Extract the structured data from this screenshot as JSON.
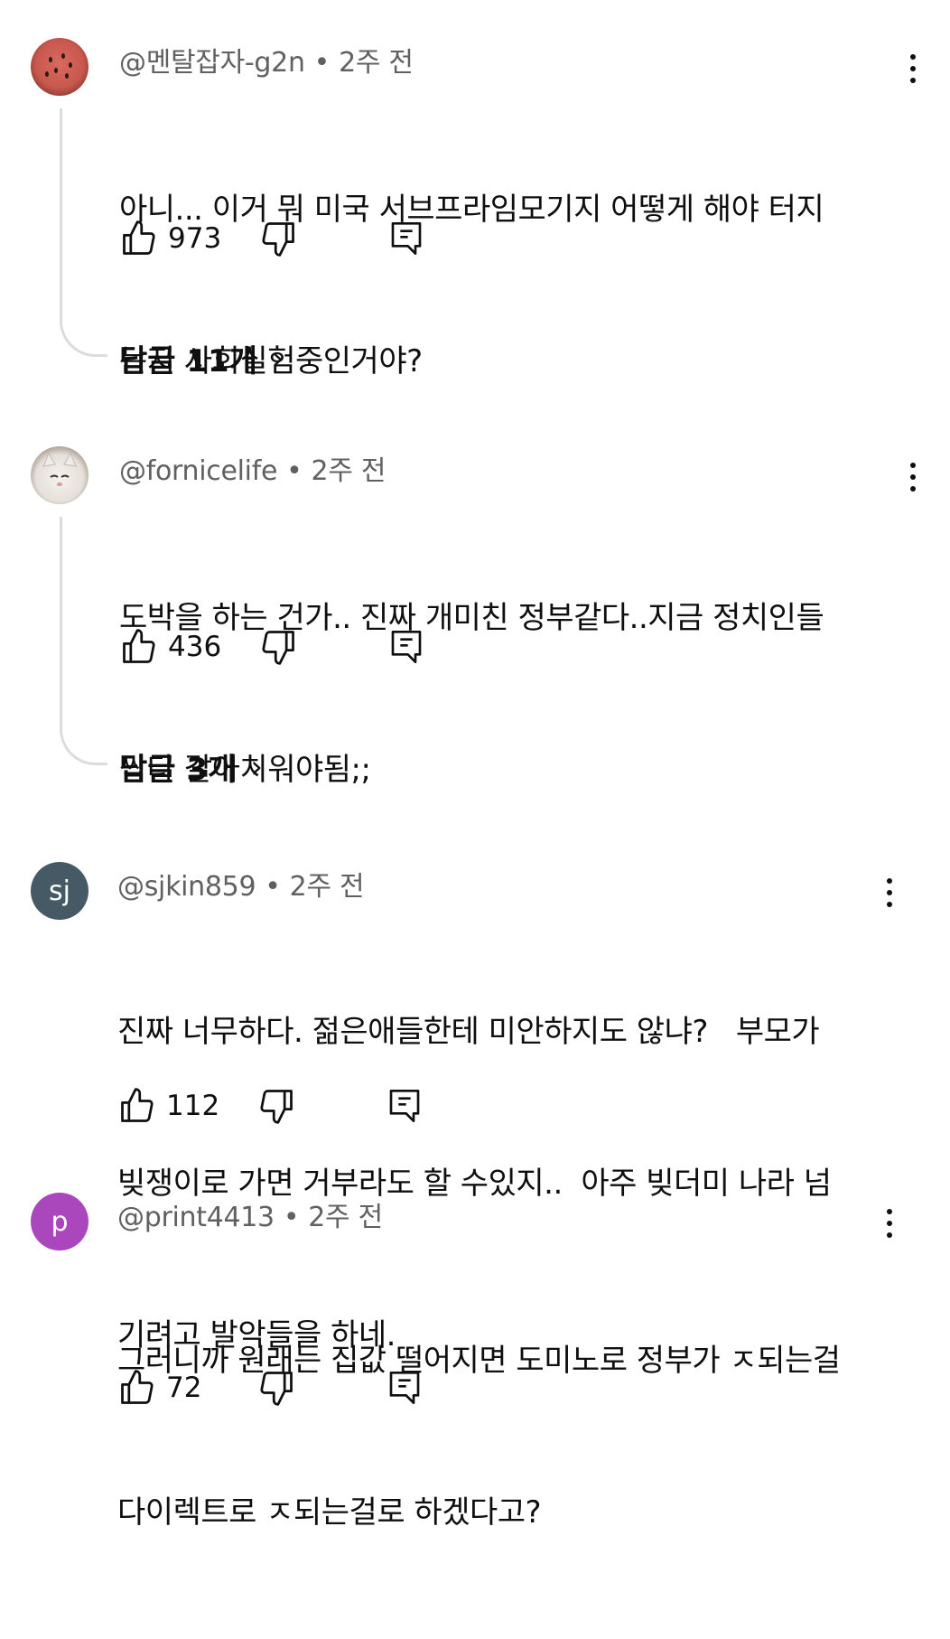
{
  "comments": [
    {
      "author": "@멘탈잡자-g2n",
      "time": "2주 전",
      "text_lines": [
        "아니... 이거 뭐 미국 서브프라임모기지 어떻게 해야 터지",
        "는지 사회실험중인거야?"
      ],
      "likes": "973",
      "replies_label": "답글 11개",
      "avatar": {
        "type": "image",
        "icon": "watermelon-avatar",
        "color": "#c9584f"
      }
    },
    {
      "author": "@fornicelife",
      "time": "2주 전",
      "text_lines": [
        "도박을 하는 건가.. 진짜 개미친 정부같다..지금 정치인들",
        "싹다 갈아치워야됨;;"
      ],
      "likes": "436",
      "replies_label": "답글 3개",
      "avatar": {
        "type": "image",
        "icon": "white-kitten-avatar",
        "color": "#e8e2dc"
      }
    },
    {
      "author": "@sjkin859",
      "time": "2주 전",
      "text_lines": [
        "진짜 너무하다. 젊은애들한테 미안하지도 않냐?   부모가",
        "빚쟁이로 가면 거부라도 할 수있지..  아주 빚더미 나라 넘",
        "기려고 발악들을 하네."
      ],
      "likes": "112",
      "avatar": {
        "type": "initials",
        "initials": "sj",
        "color": "#455a64"
      }
    },
    {
      "author": "@print4413",
      "time": "2주 전",
      "text_lines": [
        "그러니까 원래는 집값 떨어지면 도미노로 정부가 ㅈ되는걸",
        "다이렉트로 ㅈ되는걸로 하겠다고?"
      ],
      "likes": "72",
      "avatar": {
        "type": "initials",
        "initials": "p",
        "color": "#ab47bc"
      }
    }
  ]
}
